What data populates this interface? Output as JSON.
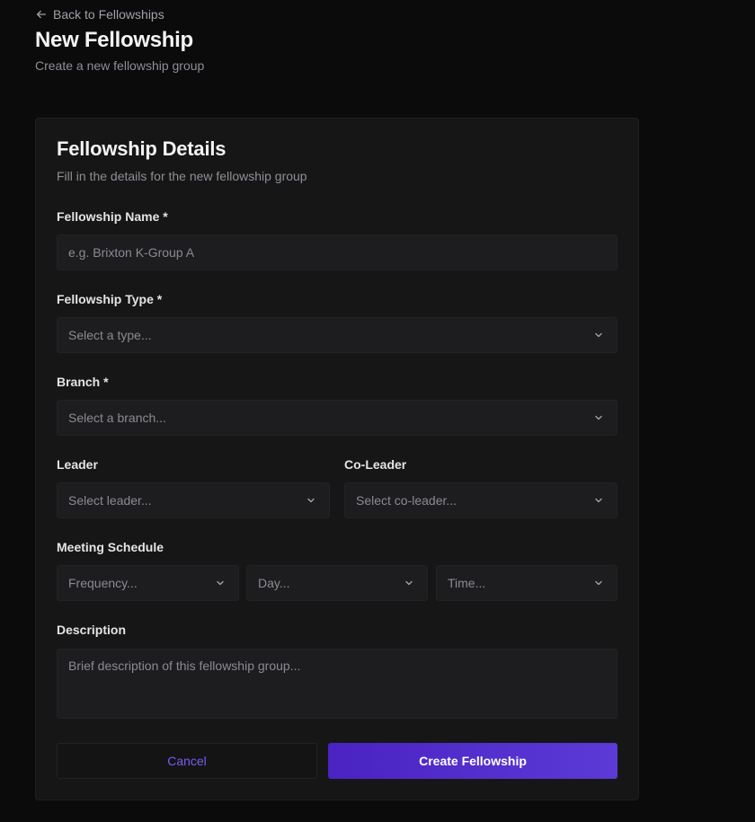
{
  "header": {
    "back_label": "Back to Fellowships",
    "title": "New Fellowship",
    "subtitle": "Create a new fellowship group"
  },
  "card": {
    "title": "Fellowship Details",
    "description": "Fill in the details for the new fellowship group"
  },
  "form": {
    "name": {
      "label": "Fellowship Name *",
      "placeholder": "e.g. Brixton K-Group A"
    },
    "type": {
      "label": "Fellowship Type *",
      "placeholder": "Select a type..."
    },
    "branch": {
      "label": "Branch *",
      "placeholder": "Select a branch..."
    },
    "leader": {
      "label": "Leader",
      "placeholder": "Select leader..."
    },
    "co_leader": {
      "label": "Co-Leader",
      "placeholder": "Select co-leader..."
    },
    "schedule": {
      "label": "Meeting Schedule",
      "frequency": "Frequency...",
      "day": "Day...",
      "time": "Time..."
    },
    "description": {
      "label": "Description",
      "placeholder": "Brief description of this fellowship group..."
    }
  },
  "actions": {
    "cancel_label": "Cancel",
    "create_label": "Create Fellowship"
  },
  "icons": {
    "back": "arrow-left-icon",
    "select": "chevron-down-icon"
  },
  "colors": {
    "background": "#0b0b0c",
    "card": "#161617",
    "input": "#1d1d1f",
    "accent": "#5b3ad6",
    "cancel_text": "#7b5cf0"
  }
}
